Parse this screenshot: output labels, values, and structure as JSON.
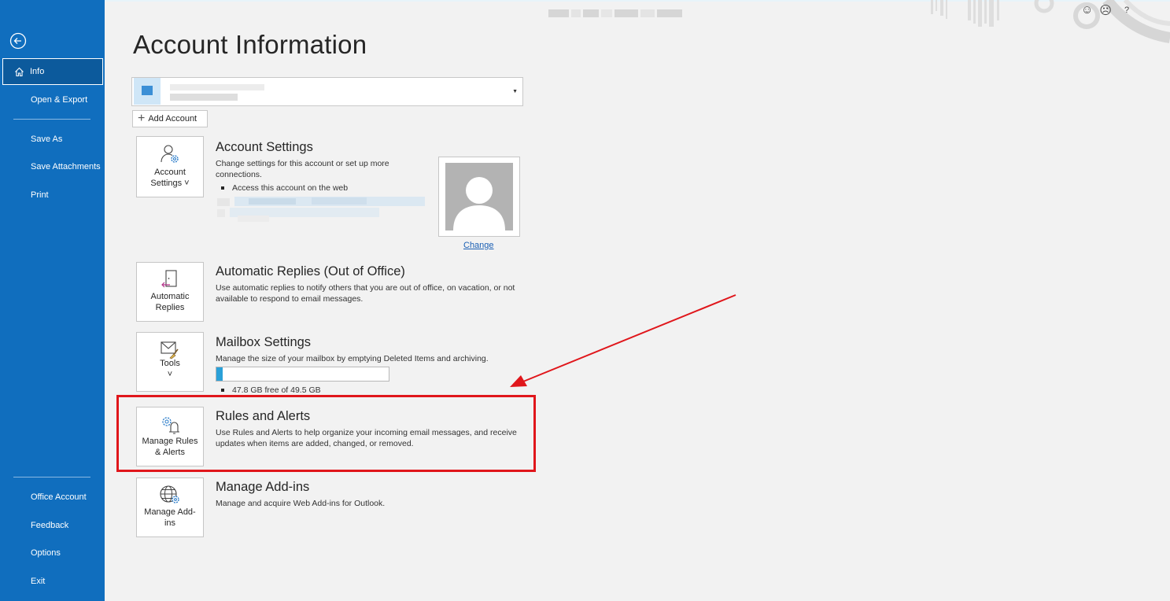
{
  "sidebar": {
    "back_label": "Back",
    "items_top": [
      {
        "label": "Info",
        "active": true
      },
      {
        "label": "Open & Export"
      }
    ],
    "items_mid": [
      {
        "label": "Save As"
      },
      {
        "label": "Save Attachments"
      },
      {
        "label": "Print"
      }
    ],
    "items_bottom": [
      {
        "label": "Office Account"
      },
      {
        "label": "Feedback"
      },
      {
        "label": "Options"
      },
      {
        "label": "Exit"
      }
    ]
  },
  "header": {
    "top_icons": [
      "☺",
      "☹",
      "?"
    ]
  },
  "main": {
    "title": "Account Information",
    "add_account_label": "Add Account",
    "sections": {
      "account_settings": {
        "tile_label_1": "Account",
        "tile_label_2": "Settings ˅",
        "title": "Account Settings",
        "desc": "Change settings for this account or set up more connections.",
        "bullet": "Access this account on the web"
      },
      "profile": {
        "change_label": "Change"
      },
      "automatic_replies": {
        "tile_label_1": "Automatic",
        "tile_label_2": "Replies",
        "title": "Automatic Replies (Out of Office)",
        "desc": "Use automatic replies to notify others that you are out of office, on vacation, or not available to respond to email messages."
      },
      "mailbox": {
        "tile_label_1": "Tools",
        "tile_label_2": "˅",
        "title": "Mailbox Settings",
        "desc": "Manage the size of your mailbox by emptying Deleted Items and archiving.",
        "usage_fraction": 0.035,
        "usage_text": "47.8 GB free of 49.5 GB"
      },
      "rules": {
        "tile_label_1": "Manage Rules",
        "tile_label_2": "& Alerts",
        "title": "Rules and Alerts",
        "desc": "Use Rules and Alerts to help organize your incoming email messages, and receive updates when items are added, changed, or removed."
      },
      "addins": {
        "tile_label_1": "Manage Add-",
        "tile_label_2": "ins",
        "title": "Manage Add-ins",
        "desc": "Manage and acquire Web Add-ins for Outlook."
      }
    }
  },
  "colors": {
    "sidebar": "#106ebe",
    "accent_progress": "#2aa0d8",
    "highlight": "#e0161b",
    "link": "#1a5fb4"
  },
  "icons": [
    "back-arrow-icon",
    "home-icon",
    "plus-icon",
    "account-settings-icon",
    "automatic-replies-icon",
    "tools-icon",
    "rules-alerts-icon",
    "add-ins-icon",
    "profile-placeholder-icon",
    "smile-icon",
    "frown-icon",
    "help-icon"
  ]
}
